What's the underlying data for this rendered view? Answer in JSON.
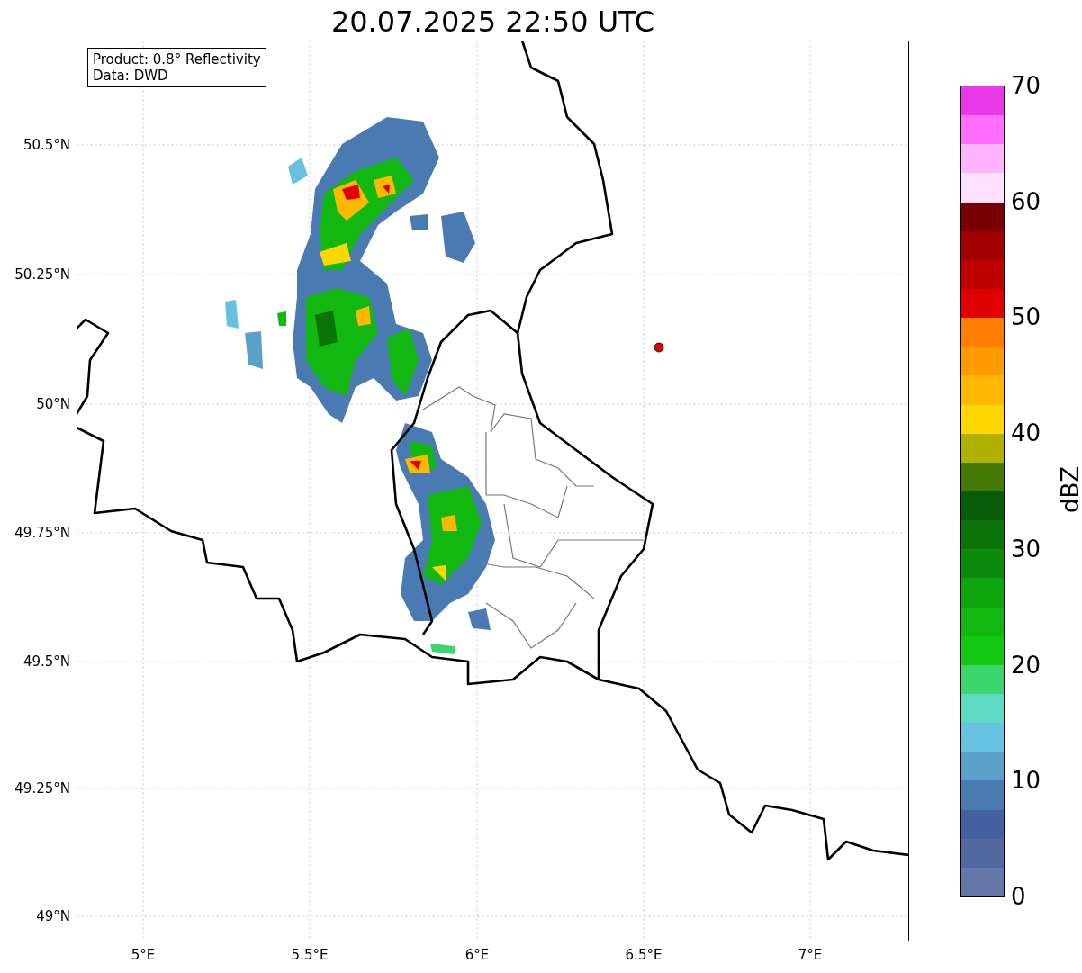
{
  "title": "20.07.2025 22:50 UTC",
  "info": [
    "Product: 0.8° Reflectivity",
    "Data: DWD"
  ],
  "x_ticks": [
    "5°E",
    "5.5°E",
    "6°E",
    "6.5°E",
    "7°E"
  ],
  "y_ticks": [
    "50.5°N",
    "50.25°N",
    "50°N",
    "49.75°N",
    "49.5°N",
    "49.25°N",
    "49°N"
  ],
  "colorbar": {
    "label": "dBZ",
    "ticks": [
      "70",
      "60",
      "50",
      "40",
      "30",
      "20",
      "10",
      "0"
    ],
    "levels": [
      {
        "color": "#e838e8"
      },
      {
        "color": "#ff6eff"
      },
      {
        "color": "#ffb4ff"
      },
      {
        "color": "#ffe0ff"
      },
      {
        "color": "#780000"
      },
      {
        "color": "#a00000"
      },
      {
        "color": "#c00000"
      },
      {
        "color": "#e00000"
      },
      {
        "color": "#ff7d00"
      },
      {
        "color": "#ff9a00"
      },
      {
        "color": "#ffb800"
      },
      {
        "color": "#ffd700"
      },
      {
        "color": "#b0b000"
      },
      {
        "color": "#467a08"
      },
      {
        "color": "#085e08"
      },
      {
        "color": "#0a740a"
      },
      {
        "color": "#0c8a0c"
      },
      {
        "color": "#0ea60e"
      },
      {
        "color": "#10b810"
      },
      {
        "color": "#12c812"
      },
      {
        "color": "#3cd66e"
      },
      {
        "color": "#5ed9c4"
      },
      {
        "color": "#66c2e0"
      },
      {
        "color": "#5aa0c8"
      },
      {
        "color": "#4a7ab2"
      },
      {
        "color": "#4460a0"
      },
      {
        "color": "#5268a0"
      },
      {
        "color": "#6477a8"
      }
    ]
  }
}
